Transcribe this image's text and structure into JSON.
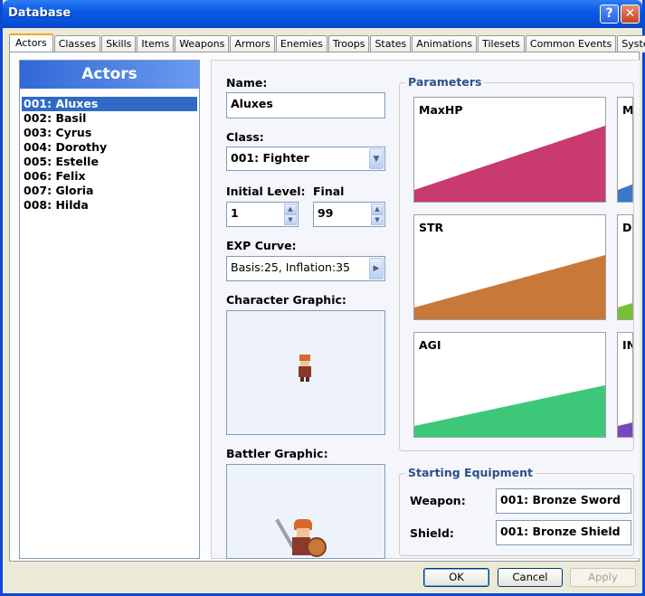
{
  "window": {
    "title": "Database",
    "help_label": "?",
    "close_label": "✕"
  },
  "tabs": [
    "Actors",
    "Classes",
    "Skills",
    "Items",
    "Weapons",
    "Armors",
    "Enemies",
    "Troops",
    "States",
    "Animations",
    "Tilesets",
    "Common Events",
    "System"
  ],
  "actors": {
    "header": "Actors",
    "items": [
      "001: Aluxes",
      "002: Basil",
      "003: Cyrus",
      "004: Dorothy",
      "005: Estelle",
      "006: Felix",
      "007: Gloria",
      "008: Hilda"
    ],
    "selected": 0
  },
  "form": {
    "name_label": "Name:",
    "name_value": "Aluxes",
    "class_label": "Class:",
    "class_value": "001: Fighter",
    "initial_level_label": "Initial Level:",
    "initial_level_value": "1",
    "final_label": "Final",
    "final_value": "99",
    "exp_label": "EXP Curve:",
    "exp_value": "Basis:25, Inflation:35",
    "char_graphic_label": "Character Graphic:",
    "battler_graphic_label": "Battler Graphic:"
  },
  "parameters": {
    "title": "Parameters",
    "graphs": [
      {
        "label": "MaxHP",
        "color": "#c83a70"
      },
      {
        "label": "M",
        "color": "#3a78c8"
      },
      {
        "label": "STR",
        "color": "#c87838"
      },
      {
        "label": "DI",
        "color": "#78c038"
      },
      {
        "label": "AGI",
        "color": "#3cc878"
      },
      {
        "label": "IN",
        "color": "#7848c0"
      }
    ]
  },
  "equipment": {
    "title": "Starting Equipment",
    "weapon_label": "Weapon:",
    "weapon_value": "001: Bronze Sword",
    "shield_label": "Shield:",
    "shield_value": "001: Bronze Shield"
  },
  "buttons": {
    "ok": "OK",
    "cancel": "Cancel",
    "apply": "Apply"
  }
}
